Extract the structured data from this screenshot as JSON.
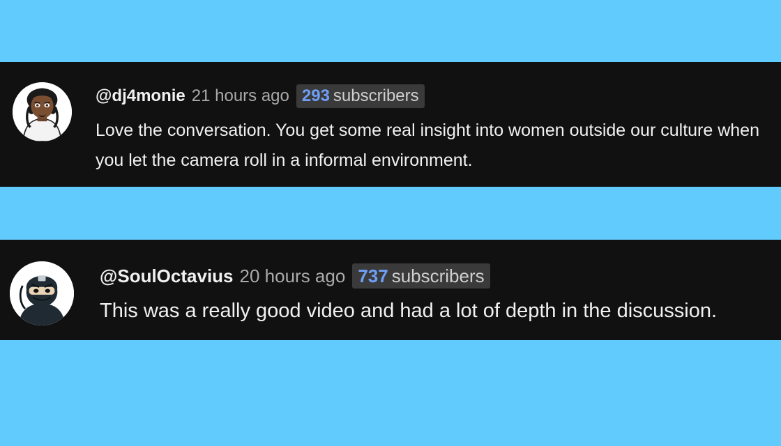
{
  "comments": [
    {
      "author": "@dj4monie",
      "time": "21 hours ago",
      "subscriber_count": "293",
      "subscriber_label": "subscribers",
      "text": "Love the conversation. You get some real insight into women outside our culture when you let the camera roll in a informal environment.",
      "avatar_icon": "cartoon-man-avatar-icon"
    },
    {
      "author": "@SoulOctavius",
      "time": "20 hours ago",
      "subscriber_count": "737",
      "subscriber_label": "subscribers",
      "text": "This was a really good video and had a lot of depth in the discussion.",
      "avatar_icon": "masked-ninja-avatar-icon"
    }
  ],
  "colors": {
    "page_background": "#62cbfd",
    "comment_background": "#111111",
    "subscriber_count": "#6f9ff5"
  }
}
